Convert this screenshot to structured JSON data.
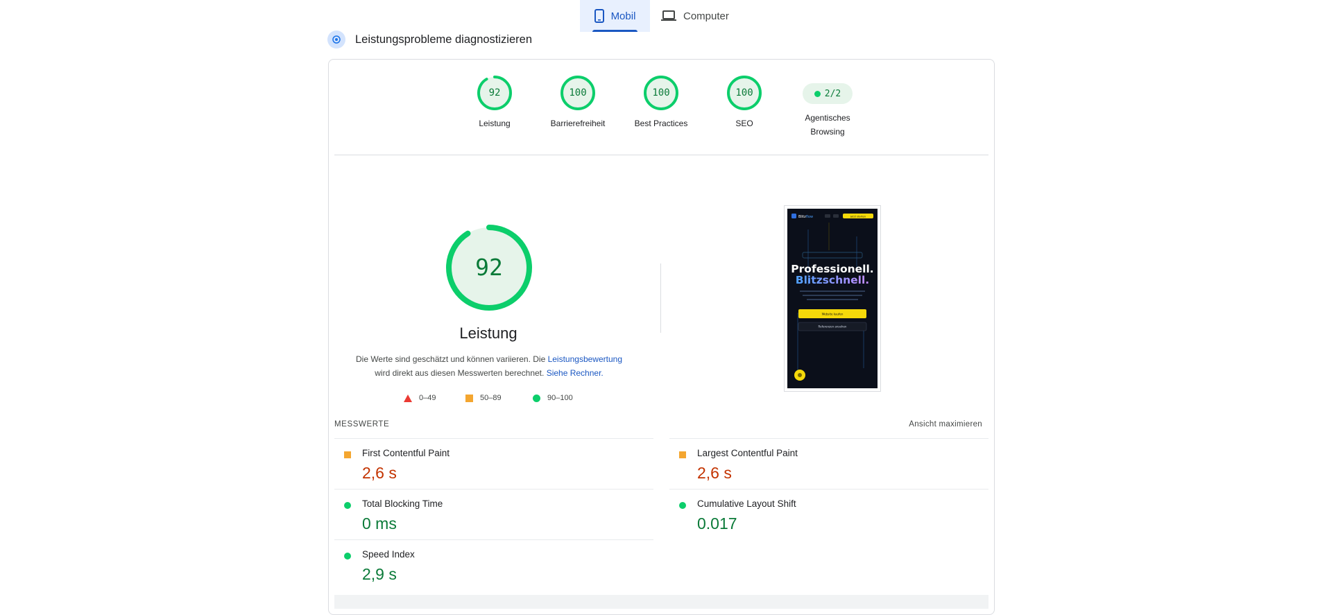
{
  "tabs": {
    "mobile": "Mobil",
    "desktop": "Computer"
  },
  "section_title": "Leistungsprobleme diagnostizieren",
  "categories": [
    {
      "score": "92",
      "label": "Leistung",
      "fraction": 0.92
    },
    {
      "score": "100",
      "label": "Barrierefreiheit",
      "fraction": 1.0
    },
    {
      "score": "100",
      "label": "Best Practices",
      "fraction": 1.0
    },
    {
      "score": "100",
      "label": "SEO",
      "fraction": 1.0
    }
  ],
  "agentic": {
    "value": "2/2",
    "label_line1": "Agentisches",
    "label_line2": "Browsing"
  },
  "performance": {
    "score": "92",
    "fraction": 0.92,
    "title": "Leistung",
    "note_part1": "Die Werte sind geschätzt und können variieren. Die ",
    "note_link1": "Leistungsbewertung",
    "note_part2": "wird direkt aus diesen Messwerten berechnet. ",
    "note_link2": "Siehe Rechner."
  },
  "legend": {
    "bad": "0–49",
    "average": "50–89",
    "good": "90–100"
  },
  "metrics_header": "MESSWERTE",
  "expand_view": "Ansicht maximieren",
  "metrics": [
    {
      "name": "First Contentful Paint",
      "value": "2,6 s",
      "rating": "average"
    },
    {
      "name": "Largest Contentful Paint",
      "value": "2,6 s",
      "rating": "average"
    },
    {
      "name": "Total Blocking Time",
      "value": "0 ms",
      "rating": "good"
    },
    {
      "name": "Cumulative Layout Shift",
      "value": "0.017",
      "rating": "good"
    },
    {
      "name": "Speed Index",
      "value": "2,9 s",
      "rating": "good"
    }
  ],
  "screenshot": {
    "brand_a": "Blitz",
    "brand_b": "flow",
    "cta_top": "Jetzt starten",
    "headline1": "Professionell.",
    "headline2": "Blitzschnell.",
    "btn_primary": "Website kaufen",
    "btn_secondary": "Referenzen ansehen"
  },
  "colors": {
    "good": "#0cce6b",
    "average": "#f4a630",
    "bad": "#eb3a33",
    "accent": "#1a57c2"
  }
}
